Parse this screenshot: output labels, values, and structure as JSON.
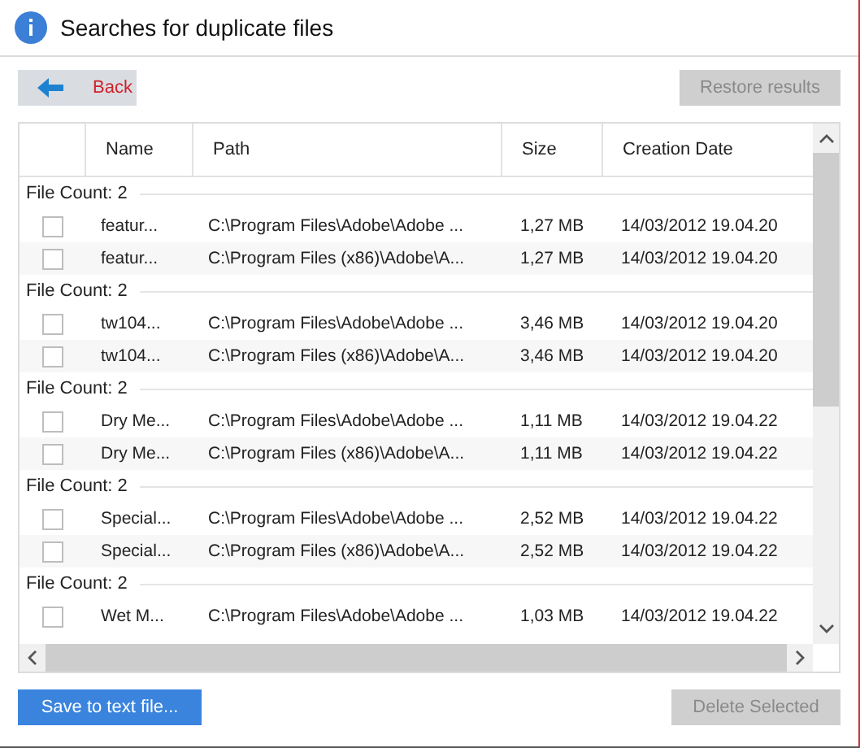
{
  "window": {
    "title": "Searches for duplicate files"
  },
  "toolbar": {
    "back": {
      "label": "Back",
      "disabled": false
    },
    "restore": {
      "label": "Restore results",
      "disabled": true
    }
  },
  "table": {
    "columns": [
      "Name",
      "Path",
      "Size",
      "Creation Date"
    ],
    "groups": [
      {
        "label": "File Count: 2",
        "files": [
          {
            "checked": false,
            "name": "featur...",
            "path": "C:\\Program Files\\Adobe\\Adobe ...",
            "size": "1,27 MB",
            "date": "14/03/2012 19.04.20"
          },
          {
            "checked": false,
            "name": "featur...",
            "path": "C:\\Program Files (x86)\\Adobe\\A...",
            "size": "1,27 MB",
            "date": "14/03/2012 19.04.20"
          }
        ]
      },
      {
        "label": "File Count: 2",
        "files": [
          {
            "checked": false,
            "name": "tw104...",
            "path": "C:\\Program Files\\Adobe\\Adobe ...",
            "size": "3,46 MB",
            "date": "14/03/2012 19.04.20"
          },
          {
            "checked": false,
            "name": "tw104...",
            "path": "C:\\Program Files (x86)\\Adobe\\A...",
            "size": "3,46 MB",
            "date": "14/03/2012 19.04.20"
          }
        ]
      },
      {
        "label": "File Count: 2",
        "files": [
          {
            "checked": false,
            "name": "Dry Me...",
            "path": "C:\\Program Files\\Adobe\\Adobe ...",
            "size": "1,11 MB",
            "date": "14/03/2012 19.04.22"
          },
          {
            "checked": false,
            "name": "Dry Me...",
            "path": "C:\\Program Files (x86)\\Adobe\\A...",
            "size": "1,11 MB",
            "date": "14/03/2012 19.04.22"
          }
        ]
      },
      {
        "label": "File Count: 2",
        "files": [
          {
            "checked": false,
            "name": "Special...",
            "path": "C:\\Program Files\\Adobe\\Adobe ...",
            "size": "2,52 MB",
            "date": "14/03/2012 19.04.22"
          },
          {
            "checked": false,
            "name": "Special...",
            "path": "C:\\Program Files (x86)\\Adobe\\A...",
            "size": "2,52 MB",
            "date": "14/03/2012 19.04.22"
          }
        ]
      },
      {
        "label": "File Count: 2",
        "files": [
          {
            "checked": false,
            "name": "Wet M...",
            "path": "C:\\Program Files\\Adobe\\Adobe ...",
            "size": "1,03 MB",
            "date": "14/03/2012 19.04.22"
          }
        ]
      }
    ]
  },
  "footer": {
    "save": {
      "label": "Save to text file...",
      "disabled": false
    },
    "delete": {
      "label": "Delete Selected",
      "disabled": true
    }
  }
}
